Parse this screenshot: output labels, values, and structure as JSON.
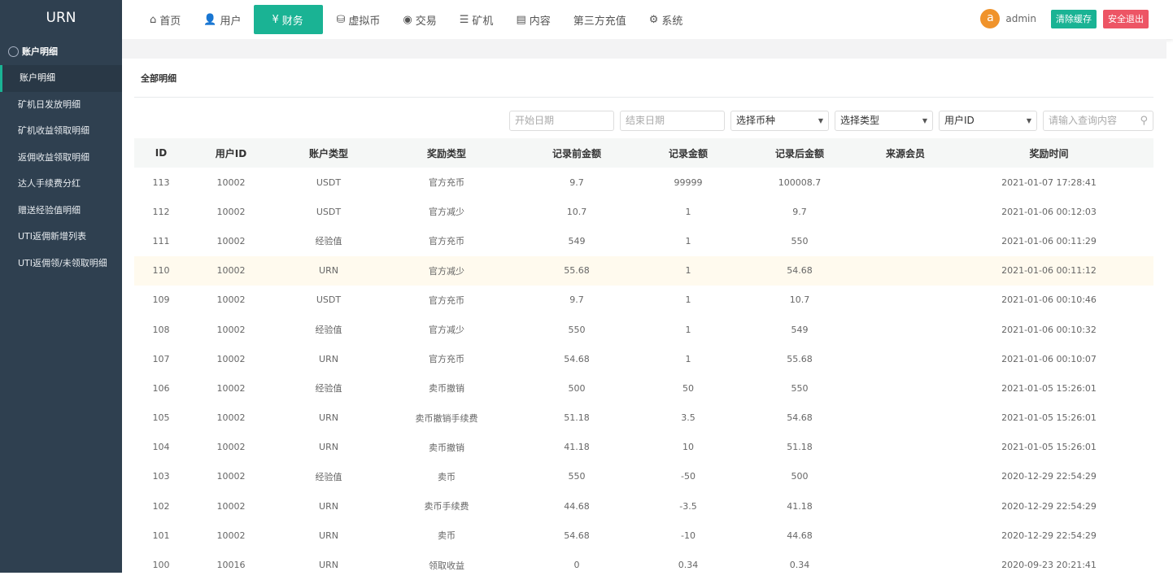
{
  "app": {
    "title": "URN"
  },
  "sidebar": {
    "group": "账户明细",
    "items": [
      {
        "label": "账户明细",
        "active": true
      },
      {
        "label": "矿机日发放明细"
      },
      {
        "label": "矿机收益领取明细"
      },
      {
        "label": "返佣收益领取明细"
      },
      {
        "label": "达人手续费分红"
      },
      {
        "label": "赠送经验值明细"
      },
      {
        "label": "UTI返佣新增列表"
      },
      {
        "label": "UTI返佣领/未领取明细"
      }
    ]
  },
  "nav": [
    {
      "label": "首页",
      "icon": "home-icon",
      "glyph": "⌂"
    },
    {
      "label": "用户",
      "icon": "user-icon",
      "glyph": "👤"
    },
    {
      "label": "财务",
      "icon": "finance-icon",
      "glyph": "¥",
      "active": true
    },
    {
      "label": "虚拟币",
      "icon": "coins-icon",
      "glyph": "⛁"
    },
    {
      "label": "交易",
      "icon": "exchange-icon",
      "glyph": "◉"
    },
    {
      "label": "矿机",
      "icon": "server-icon",
      "glyph": "☰"
    },
    {
      "label": "内容",
      "icon": "document-icon",
      "glyph": "▤"
    },
    {
      "label": "第三方充值",
      "icon": "",
      "glyph": ""
    },
    {
      "label": "系统",
      "icon": "gear-icon",
      "glyph": "⚙"
    }
  ],
  "user": {
    "avatar": "a",
    "name": "admin",
    "clear_cache": "清除缓存",
    "logout": "安全退出"
  },
  "colors": {
    "accent": "#1ab394",
    "danger": "#ed5565",
    "sidebar": "#2f4050",
    "avatar": "#f0932b"
  },
  "page": {
    "title": "全部明细"
  },
  "filters": {
    "start_date": "开始日期",
    "end_date": "结束日期",
    "currency": "选择币种",
    "type": "选择类型",
    "user_id": "用户ID",
    "search": "请输入查询内容"
  },
  "table": {
    "headers": [
      "ID",
      "用户ID",
      "账户类型",
      "奖励类型",
      "记录前金额",
      "记录金额",
      "记录后金额",
      "来源会员",
      "奖励时间"
    ],
    "rows": [
      [
        "113",
        "10002",
        "USDT",
        "官方充币",
        "9.7",
        "99999",
        "100008.7",
        "",
        "2021-01-07 17:28:41"
      ],
      [
        "112",
        "10002",
        "USDT",
        "官方减少",
        "10.7",
        "1",
        "9.7",
        "",
        "2021-01-06 00:12:03"
      ],
      [
        "111",
        "10002",
        "经验值",
        "官方充币",
        "549",
        "1",
        "550",
        "",
        "2021-01-06 00:11:29"
      ],
      [
        "110",
        "10002",
        "URN",
        "官方减少",
        "55.68",
        "1",
        "54.68",
        "",
        "2021-01-06 00:11:12"
      ],
      [
        "109",
        "10002",
        "USDT",
        "官方充币",
        "9.7",
        "1",
        "10.7",
        "",
        "2021-01-06 00:10:46"
      ],
      [
        "108",
        "10002",
        "经验值",
        "官方减少",
        "550",
        "1",
        "549",
        "",
        "2021-01-06 00:10:32"
      ],
      [
        "107",
        "10002",
        "URN",
        "官方充币",
        "54.68",
        "1",
        "55.68",
        "",
        "2021-01-06 00:10:07"
      ],
      [
        "106",
        "10002",
        "经验值",
        "卖币撤销",
        "500",
        "50",
        "550",
        "",
        "2021-01-05 15:26:01"
      ],
      [
        "105",
        "10002",
        "URN",
        "卖币撤销手续费",
        "51.18",
        "3.5",
        "54.68",
        "",
        "2021-01-05 15:26:01"
      ],
      [
        "104",
        "10002",
        "URN",
        "卖币撤销",
        "41.18",
        "10",
        "51.18",
        "",
        "2021-01-05 15:26:01"
      ],
      [
        "103",
        "10002",
        "经验值",
        "卖币",
        "550",
        "-50",
        "500",
        "",
        "2020-12-29 22:54:29"
      ],
      [
        "102",
        "10002",
        "URN",
        "卖币手续费",
        "44.68",
        "-3.5",
        "41.18",
        "",
        "2020-12-29 22:54:29"
      ],
      [
        "101",
        "10002",
        "URN",
        "卖币",
        "54.68",
        "-10",
        "44.68",
        "",
        "2020-12-29 22:54:29"
      ],
      [
        "100",
        "10016",
        "URN",
        "领取收益",
        "0",
        "0.34",
        "0.34",
        "",
        "2020-09-23 20:21:41"
      ]
    ]
  }
}
